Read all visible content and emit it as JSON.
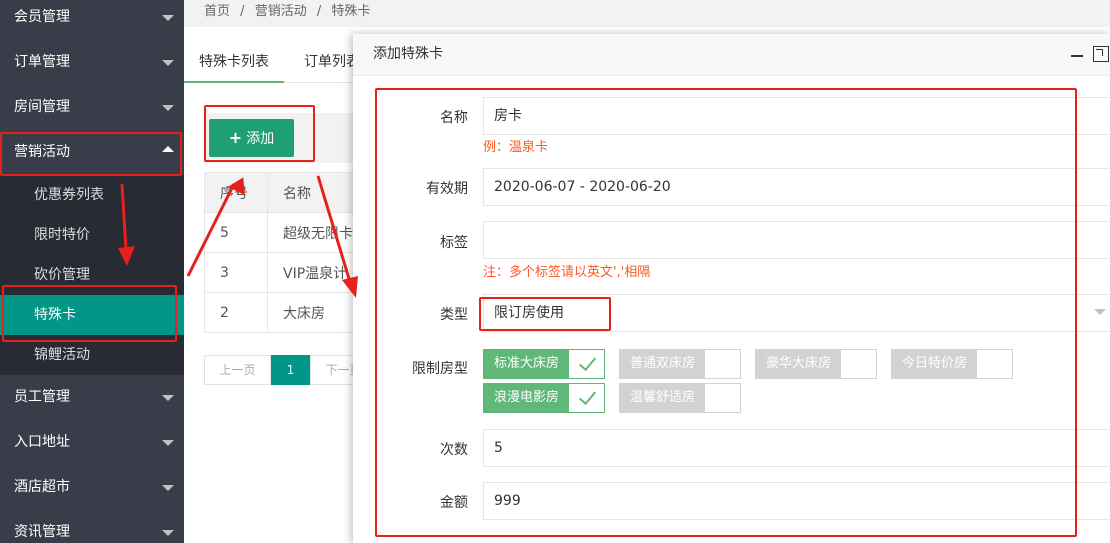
{
  "sidebar": {
    "items": [
      {
        "label": "会员管理"
      },
      {
        "label": "订单管理"
      },
      {
        "label": "房间管理"
      },
      {
        "label": "营销活动"
      },
      {
        "label": "员工管理"
      },
      {
        "label": "入口地址"
      },
      {
        "label": "酒店超市"
      },
      {
        "label": "资讯管理"
      }
    ],
    "submenu": [
      {
        "label": "优惠券列表"
      },
      {
        "label": "限时特价"
      },
      {
        "label": "砍价管理"
      },
      {
        "label": "特殊卡"
      },
      {
        "label": "锦鲤活动"
      }
    ]
  },
  "breadcrumb": [
    "首页",
    "/",
    "营销活动",
    "/",
    "特殊卡"
  ],
  "tabs": [
    "特殊卡列表",
    "订单列表"
  ],
  "toolbar": {
    "add_label": "添加"
  },
  "table": {
    "headers": [
      "序号",
      "名称"
    ],
    "rows": [
      [
        "5",
        "超级无限卡"
      ],
      [
        "3",
        "VIP温泉计"
      ],
      [
        "2",
        "大床房"
      ]
    ]
  },
  "pager": {
    "prev": "上一页",
    "current": "1",
    "next": "下一页"
  },
  "modal": {
    "title": "添加特殊卡",
    "fields": {
      "name": {
        "label": "名称",
        "value": "房卡",
        "hint": "例：温泉卡"
      },
      "validity": {
        "label": "有效期",
        "value": "2020-06-07 - 2020-06-20"
      },
      "tags": {
        "label": "标签",
        "value": "",
        "hint": "注：多个标签请以英文','相隔"
      },
      "type": {
        "label": "类型",
        "value": "限订房使用"
      },
      "room_types": {
        "label": "限制房型",
        "options": [
          {
            "label": "标准大床房",
            "checked": true
          },
          {
            "label": "普通双床房",
            "checked": false
          },
          {
            "label": "豪华大床房",
            "checked": false
          },
          {
            "label": "今日特价房",
            "checked": false
          },
          {
            "label": "浪漫电影房",
            "checked": true
          },
          {
            "label": "温馨舒适房",
            "checked": false
          }
        ]
      },
      "count": {
        "label": "次数",
        "value": "5"
      },
      "amount": {
        "label": "金额",
        "value": "999"
      }
    }
  },
  "colors": {
    "sidebar_bg": "#393d49",
    "active_green": "#009688",
    "checkbox_green": "#5fb878",
    "hint_orange": "#ff5722",
    "annotation_red": "#e8201c"
  }
}
